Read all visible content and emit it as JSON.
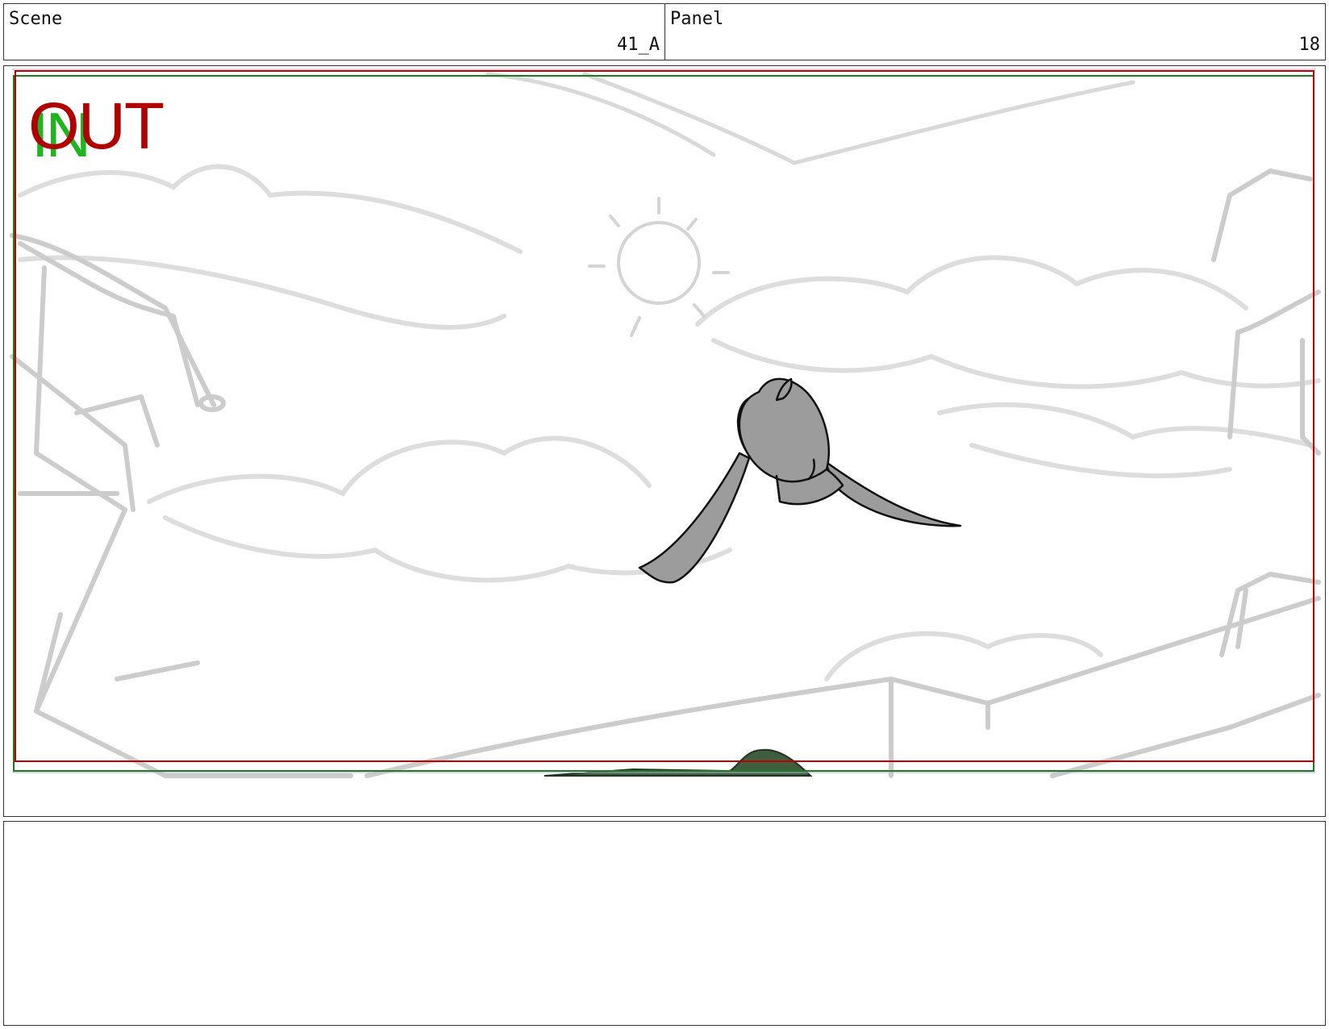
{
  "header": {
    "scene_label": "Scene",
    "scene_value": "41_A",
    "panel_label": "Panel",
    "panel_value": "18"
  },
  "frame": {
    "in_label": "IN",
    "out_label": "OUT",
    "colors": {
      "in_guide": "#1f7a1f",
      "out_guide": "#c00000",
      "sketch": "#cfcfcf",
      "character_fill": "#999999",
      "character_outline": "#111111"
    }
  },
  "notes": {
    "text": ""
  }
}
